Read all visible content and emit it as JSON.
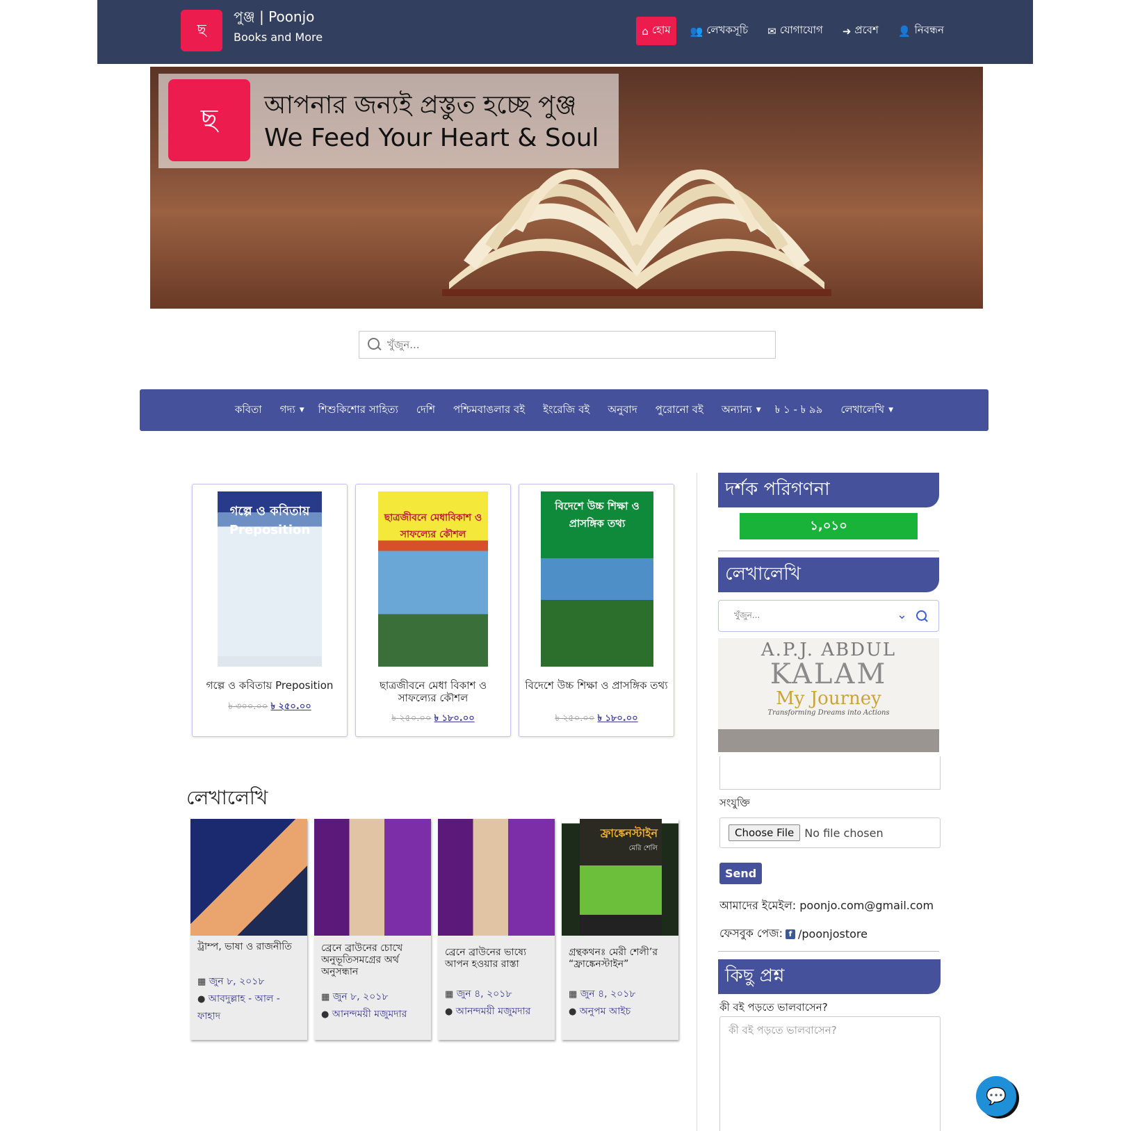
{
  "header": {
    "logo_text": "ছ",
    "site_title": "পুঞ্জ | Poonjo",
    "tagline": "Books and More",
    "nav": [
      {
        "icon": "home-icon",
        "glyph": "⌂",
        "label": "হোম"
      },
      {
        "icon": "users-icon",
        "glyph": "👥",
        "label": "লেখকসূচি"
      },
      {
        "icon": "envelope-icon",
        "glyph": "✉",
        "label": "যোগাযোগ"
      },
      {
        "icon": "sign-in-icon",
        "glyph": "➜",
        "label": "প্রবেশ"
      },
      {
        "icon": "user-plus-icon",
        "glyph": "👤",
        "label": "নিবন্ধন"
      }
    ]
  },
  "banner": {
    "logo_text": "ছ",
    "line1": "আপনার জন্যই প্রস্তুত হচ্ছে পুঞ্জ",
    "line2": "We Feed Your Heart & Soul"
  },
  "search": {
    "placeholder": "খুঁজুন..."
  },
  "categories": [
    {
      "label": "কবিতা",
      "dropdown": ""
    },
    {
      "label": "গদ্য",
      "dropdown": "▼"
    },
    {
      "label": "শিশুকিশোর সাহিত্য",
      "dropdown": ""
    },
    {
      "label": "দেশি",
      "dropdown": ""
    },
    {
      "label": "পশ্চিমবাঙলার বই",
      "dropdown": ""
    },
    {
      "label": "ইংরেজি বই",
      "dropdown": ""
    },
    {
      "label": "অনুবাদ",
      "dropdown": ""
    },
    {
      "label": "পুরোনো বই",
      "dropdown": ""
    },
    {
      "label": "অন্যান্য",
      "dropdown": "▼"
    },
    {
      "label": "৳ ১ - ৳ ৯৯",
      "dropdown": ""
    },
    {
      "label": "লেখালেখি",
      "dropdown": "▼"
    }
  ],
  "products": [
    {
      "cover_text": "গল্পে ও কবিতায় Preposition",
      "title": "গল্পে ও কবিতায় Preposition",
      "old_price": "৳ ৩০০.০০",
      "new_price": "৳ ২৫০.০০"
    },
    {
      "cover_text": "ছাত্রজীবনে মেধাবিকাশ ও সাফল্যের কৌশল",
      "title": "ছাত্রজীবনে মেধা বিকাশ ও সাফল্যের কৌশল",
      "old_price": "৳ ২৫০.০০",
      "new_price": "৳ ১৮০.০০"
    },
    {
      "cover_text": "বিদেশে উচ্চ শিক্ষা ও প্রাসঙ্গিক তথ্য",
      "title": "বিদেশে উচ্চ শিক্ষা ও প্রাসঙ্গিক তথ্য",
      "old_price": "৳ ২৫০.০০",
      "new_price": "৳ ১৮০.০০"
    }
  ],
  "lekhalekhi": {
    "heading": "লেখালেখি",
    "posts": [
      {
        "title": "ট্রাম্প, ভাষা ও রাজনীতি",
        "date": "জুন ৮, ২০১৮",
        "author": "আবদুল্লাহ - আল - ফাহাদ"
      },
      {
        "title": "ব্রেনে ব্রাউনের চোখে অনুভূতিসমগ্রের অর্থ অনুসন্ধান",
        "date": "জুন ৮, ২০১৮",
        "author": "আনন্দময়ী মজুমদার"
      },
      {
        "title": "ব্রেনে ব্রাউনের ভাষ্যে আপন হওয়ার রাস্তা",
        "date": "জুন ৪, ২০১৮",
        "author": "আনন্দময়ী মজুমদার"
      },
      {
        "title": "গ্রন্থকথনঃ মেরী শেলী’র “ফ্রাঙ্কেনস্টাইন”",
        "date": "জুন ৪, ২০১৮",
        "author": "অনুপম আইচ",
        "cover_title": "ফ্রাঙ্কেনস্টাইন",
        "cover_sub": "মেরি শেলি"
      }
    ]
  },
  "sidebar": {
    "visitor_heading": "দর্শক পরিগণনা",
    "visitor_count": "১,০১০",
    "lekhalekhi_heading": "লেখালেখি",
    "search_placeholder": "খুঁজুন...",
    "book": {
      "line1": "A.P.J. ABDUL",
      "line2": "KALAM",
      "line3": "My Journey",
      "line4": "Transforming Dreams into Actions"
    },
    "attachment_label": "সংযুক্তি",
    "file_button": "Choose File",
    "file_status": "No file chosen",
    "send_label": "Send",
    "email_text": "আমাদের ইমেইল: poonjo.com@gmail.com",
    "facebook_prefix": "ফেসবুক পেজ:",
    "facebook_handle": "/poonjostore",
    "question_heading": "কিছু প্রশ্ন",
    "question_label": "কী বই পড়তে ভালবাসেন?",
    "question_placeholder": "কী বই পড়তে ভালবাসেন?"
  },
  "colors": {
    "brand": "#ec1c4f",
    "header_bg": "#333f5f",
    "accent": "#45519a",
    "counter": "#19b33a"
  }
}
